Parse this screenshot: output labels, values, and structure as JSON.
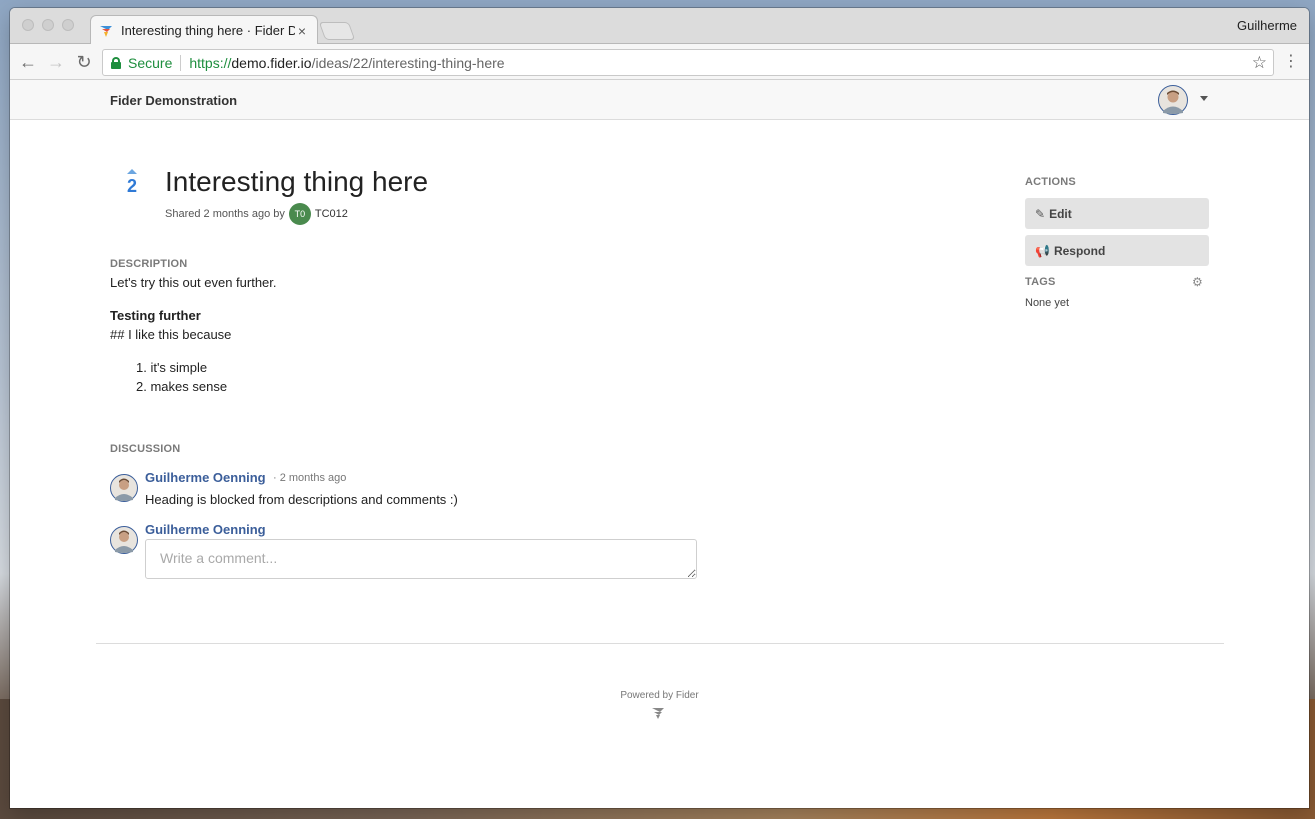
{
  "browser": {
    "tab_title": "Interesting thing here · Fider D",
    "tab_close": "×",
    "profile_name": "Guilherme",
    "secure_label": "Secure",
    "url_scheme": "https://",
    "url_host": "demo.fider.io",
    "url_path": "/ideas/22/interesting-thing-here",
    "back": "←",
    "forward": "→",
    "reload": "↻",
    "star": "☆",
    "menu": "⋮"
  },
  "site": {
    "title": "Fider Demonstration"
  },
  "idea": {
    "votes": "2",
    "title": "Interesting thing here",
    "meta_prefix": "Shared 2 months ago by",
    "author_initials": "T0",
    "author_name": "TC012",
    "description_label": "DESCRIPTION",
    "description_text": "Let's try this out even further.",
    "description_heading": "Testing further",
    "description_line2": "## I like this because",
    "description_list": [
      "1. it's simple",
      "2. makes sense"
    ]
  },
  "discussion": {
    "label": "DISCUSSION",
    "comments": [
      {
        "author": "Guilherme Oenning",
        "time": "· 2 months ago",
        "body": "Heading is blocked from descriptions and comments :)"
      }
    ],
    "current_user": "Guilherme Oenning",
    "input_placeholder": "Write a comment..."
  },
  "sidebar": {
    "actions_label": "ACTIONS",
    "edit_label": "Edit",
    "respond_label": "Respond",
    "tags_label": "TAGS",
    "tags_empty": "None yet"
  },
  "footer": {
    "powered_by": "Powered by Fider"
  },
  "colors": {
    "link": "#3b5e9a",
    "vote": "#2f7ad6",
    "secure": "#1e8e3e"
  }
}
